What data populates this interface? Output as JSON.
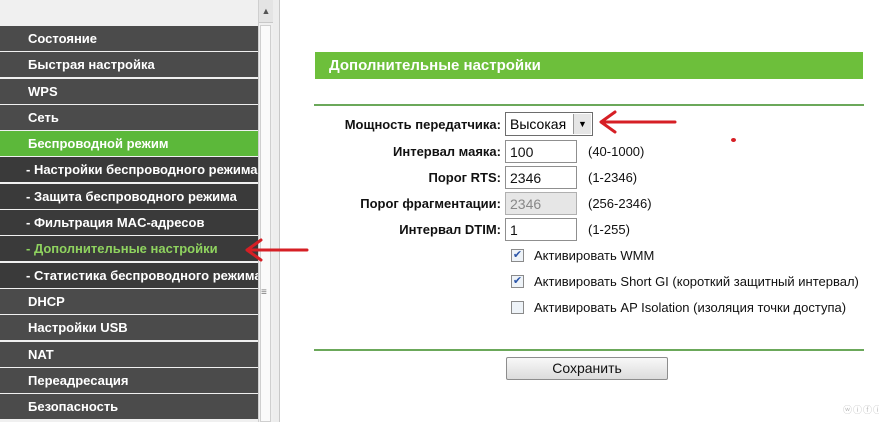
{
  "sidebar": {
    "items": [
      {
        "label": "Состояние"
      },
      {
        "label": "Быстрая настройка"
      },
      {
        "label": "WPS"
      },
      {
        "label": "Сеть"
      },
      {
        "label": "Беспроводной режим"
      },
      {
        "label": "- Настройки беспроводного режима"
      },
      {
        "label": "- Защита беспроводного режима"
      },
      {
        "label": "- Фильтрация MAC-адресов"
      },
      {
        "label": "- Дополнительные настройки"
      },
      {
        "label": "- Статистика беспроводного режима"
      },
      {
        "label": "DHCP"
      },
      {
        "label": "Настройки USB"
      },
      {
        "label": "NAT"
      },
      {
        "label": "Переадресация"
      },
      {
        "label": "Безопасность"
      }
    ]
  },
  "main": {
    "title": "Дополнительные настройки",
    "tx_power": {
      "label": "Мощность передатчика:",
      "value": "Высокая"
    },
    "beacon_interval": {
      "label": "Интервал маяка:",
      "value": "100",
      "hint": "(40-1000)"
    },
    "rts_threshold": {
      "label": "Порог RTS:",
      "value": "2346",
      "hint": "(1-2346)"
    },
    "fragmentation_threshold": {
      "label": "Порог фрагментации:",
      "value": "2346",
      "hint": "(256-2346)"
    },
    "dtim_interval": {
      "label": "Интервал DTIM:",
      "value": "1",
      "hint": "(1-255)"
    },
    "checkboxes": [
      {
        "label": "Активировать WMM",
        "checked": true
      },
      {
        "label": "Активировать Short GI (короткий защитный интервал)",
        "checked": true
      },
      {
        "label": "Активировать AP Isolation (изоляция точки доступа)",
        "checked": false
      }
    ],
    "save_label": "Сохранить"
  },
  "colors": {
    "accent_green": "#6dbf3b",
    "menu_bg": "#4b4b4b",
    "menu_sub_bg": "#3a3a3a",
    "annotation_red": "#d61f25"
  },
  "watermark": "ⓦⓘⓕⓘ"
}
